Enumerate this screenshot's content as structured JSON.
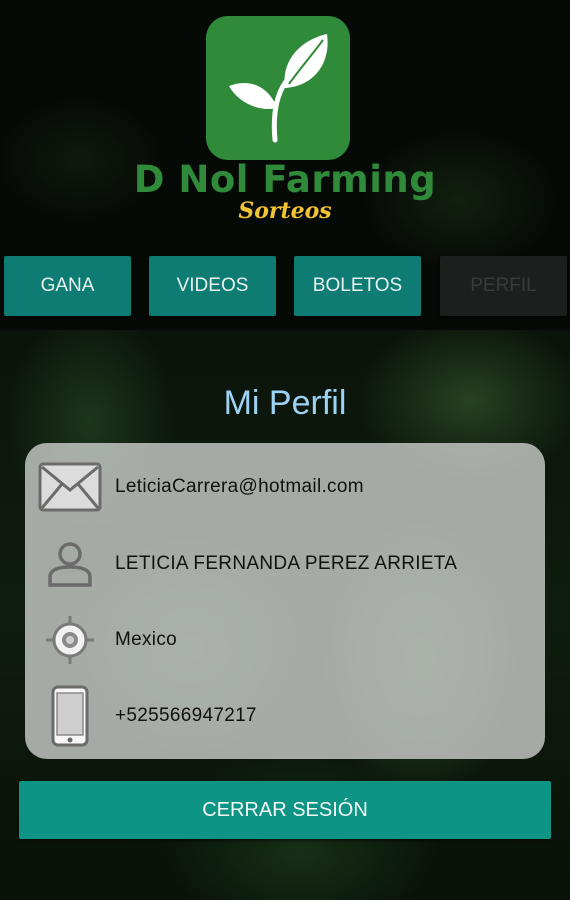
{
  "brand": {
    "name": "D Nol Farming",
    "subtitle": "Sorteos"
  },
  "tabs": [
    {
      "label": "GANA",
      "enabled": true
    },
    {
      "label": "VIDEOS",
      "enabled": true
    },
    {
      "label": "BOLETOS",
      "enabled": true
    },
    {
      "label": "PERFIL",
      "enabled": false
    }
  ],
  "profile": {
    "title": "Mi Perfil",
    "fields": [
      {
        "icon": "envelope-icon",
        "value": "LeticiaCarrera@hotmail.com"
      },
      {
        "icon": "person-icon",
        "value": "LETICIA FERNANDA PEREZ ARRIETA"
      },
      {
        "icon": "location-target-icon",
        "value": "Mexico"
      },
      {
        "icon": "phone-icon",
        "value": "+525566947217"
      }
    ]
  },
  "logout_label": "CERRAR SESIÓN",
  "colors": {
    "accent": "#0e9484",
    "brand_green": "#2f8b3a",
    "subtitle_gold": "#f1c232",
    "title_blue": "#9ed2f4"
  }
}
